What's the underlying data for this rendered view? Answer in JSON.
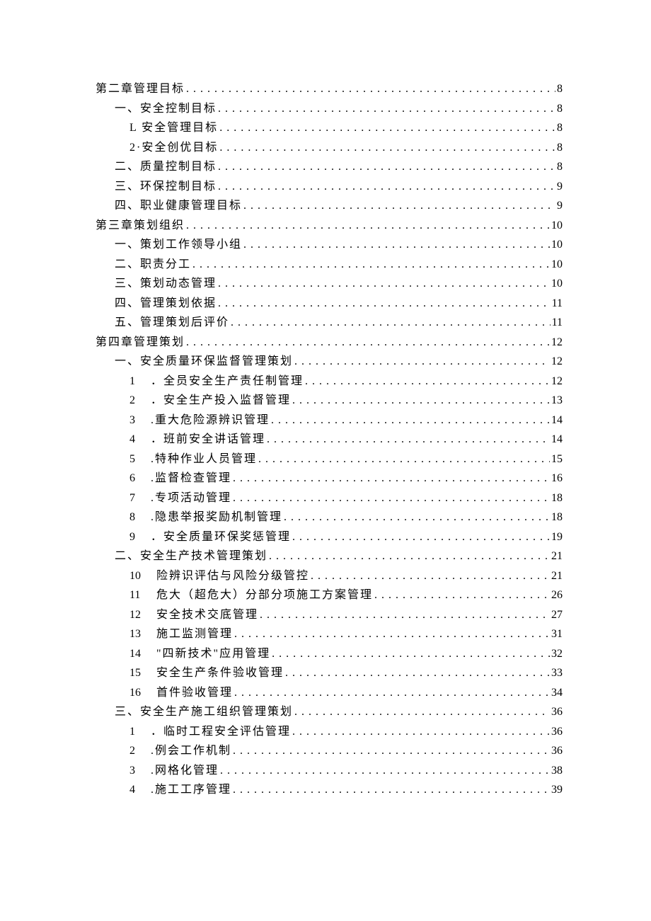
{
  "toc": [
    {
      "indent": 0,
      "prefix": "",
      "title": "第二章管理目标",
      "page": "8"
    },
    {
      "indent": 1,
      "prefix": "",
      "title": "一、安全控制目标",
      "page": "8"
    },
    {
      "indent": 2,
      "prefix": "",
      "title": "L 安全管理目标",
      "page": "8"
    },
    {
      "indent": 2,
      "prefix": "",
      "title": "2·安全创优目标",
      "page": "8"
    },
    {
      "indent": 1,
      "prefix": "",
      "title": "二、质量控制目标",
      "page": "8"
    },
    {
      "indent": 1,
      "prefix": "",
      "title": "三、环保控制目标",
      "page": "9"
    },
    {
      "indent": 1,
      "prefix": "",
      "title": "四、职业健康管理目标",
      "page": "9"
    },
    {
      "indent": 0,
      "prefix": "",
      "title": "第三章策划组织",
      "page": "10"
    },
    {
      "indent": 1,
      "prefix": "",
      "title": "一、策划工作领导小组",
      "page": "10"
    },
    {
      "indent": 1,
      "prefix": "",
      "title": "二、职责分工",
      "page": "10"
    },
    {
      "indent": 1,
      "prefix": "",
      "title": "三、策划动态管理",
      "page": "10"
    },
    {
      "indent": 1,
      "prefix": "",
      "title": "四、管理策划依据",
      "page": "11"
    },
    {
      "indent": 1,
      "prefix": "",
      "title": "五、管理策划后评价",
      "page": "11"
    },
    {
      "indent": 0,
      "prefix": "",
      "title": "第四章管理策划",
      "page": "12"
    },
    {
      "indent": 1,
      "prefix": "",
      "title": "一、安全质量环保监督管理策划",
      "page": "12"
    },
    {
      "indent": 3,
      "prefix": "1",
      "title": "．全员安全生产责任制管理",
      "page": "12"
    },
    {
      "indent": 3,
      "prefix": "2",
      "title": "．安全生产投入监督管理",
      "page": "13"
    },
    {
      "indent": 3,
      "prefix": "3",
      "title": ".重大危险源辨识管理",
      "page": "14"
    },
    {
      "indent": 3,
      "prefix": "4",
      "title": "．班前安全讲话管理",
      "page": "14"
    },
    {
      "indent": 3,
      "prefix": "5",
      "title": ".特种作业人员管理",
      "page": "15"
    },
    {
      "indent": 3,
      "prefix": "6",
      "title": ".监督检查管理",
      "page": "16"
    },
    {
      "indent": 3,
      "prefix": "7",
      "title": ".专项活动管理",
      "page": "18"
    },
    {
      "indent": 3,
      "prefix": "8",
      "title": ".隐患举报奖励机制管理",
      "page": "18"
    },
    {
      "indent": 3,
      "prefix": "9",
      "title": "．安全质量环保奖惩管理",
      "page": "19"
    },
    {
      "indent": 1,
      "prefix": "",
      "title": "二、安全生产技术管理策划",
      "page": "21"
    },
    {
      "indent": 3,
      "prefix": "10",
      "title": "    险辨识评估与风险分级管控",
      "page": "21",
      "wide": true
    },
    {
      "indent": 3,
      "prefix": "11",
      "title": " 危大（超危大）分部分项施工方案管理",
      "page": "26",
      "wide": true
    },
    {
      "indent": 3,
      "prefix": "12",
      "title": " 安全技术交底管理",
      "page": "27",
      "wide": true
    },
    {
      "indent": 3,
      "prefix": "13",
      "title": " 施工监测管理",
      "page": "31",
      "wide": true
    },
    {
      "indent": 3,
      "prefix": "14",
      "title": " \"四新技术\"应用管理",
      "page": "32",
      "wide": true
    },
    {
      "indent": 3,
      "prefix": "15",
      "title": " 安全生产条件验收管理",
      "page": "33",
      "wide": true
    },
    {
      "indent": 3,
      "prefix": "16",
      "title": " 首件验收管理",
      "page": "34",
      "wide": true
    },
    {
      "indent": 1,
      "prefix": "",
      "title": "三、安全生产施工组织管理策划",
      "page": "36"
    },
    {
      "indent": 3,
      "prefix": "1",
      "title": "．临时工程安全评估管理",
      "page": "36"
    },
    {
      "indent": 3,
      "prefix": "2",
      "title": ".例会工作机制",
      "page": "36"
    },
    {
      "indent": 3,
      "prefix": "3",
      "title": ".网格化管理",
      "page": "38"
    },
    {
      "indent": 3,
      "prefix": "4",
      "title": ".施工工序管理",
      "page": "39"
    }
  ]
}
